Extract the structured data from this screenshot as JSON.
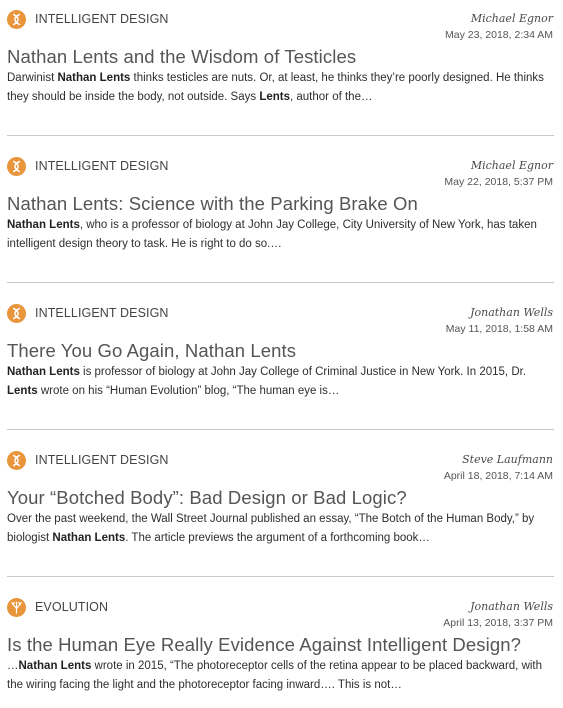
{
  "colors": {
    "accent": "#e8953c",
    "icon_evolution": "#e8953c",
    "divider": "#c9c9c9"
  },
  "articles": [
    {
      "category": "INTELLIGENT DESIGN",
      "category_icon": "dna-helix-icon",
      "author": "Michael Egnor",
      "date": "May 23, 2018, 2:34 AM",
      "title": "Nathan Lents and the Wisdom of Testicles",
      "excerpt": [
        {
          "text": "Darwinist ",
          "bold": false
        },
        {
          "text": "Nathan Lents",
          "bold": true
        },
        {
          "text": " thinks testicles are nuts. Or, at least, he thinks they’re poorly designed. He thinks they should be inside the body, not outside. Says ",
          "bold": false
        },
        {
          "text": "Lents",
          "bold": true
        },
        {
          "text": ", author of the…",
          "bold": false
        }
      ]
    },
    {
      "category": "INTELLIGENT DESIGN",
      "category_icon": "dna-helix-icon",
      "author": "Michael Egnor",
      "date": "May 22, 2018, 5:37 PM",
      "title": "Nathan Lents: Science with the Parking Brake On",
      "excerpt": [
        {
          "text": "Nathan Lents",
          "bold": true
        },
        {
          "text": ", who is a professor of biology at John Jay College, City University of New York, has taken intelligent design theory to task. He is right to do so.…",
          "bold": false
        }
      ]
    },
    {
      "category": "INTELLIGENT DESIGN",
      "category_icon": "dna-helix-icon",
      "author": "Jonathan Wells",
      "date": "May 11, 2018, 1:58 AM",
      "title": "There You Go Again, Nathan Lents",
      "excerpt": [
        {
          "text": "Nathan Lents",
          "bold": true
        },
        {
          "text": " is professor of biology at John Jay College of Criminal Justice in New York. In 2015, Dr. ",
          "bold": false
        },
        {
          "text": "Lents",
          "bold": true
        },
        {
          "text": " wrote on his “Human Evolution” blog, “The human eye is…",
          "bold": false
        }
      ]
    },
    {
      "category": "INTELLIGENT DESIGN",
      "category_icon": "dna-helix-icon",
      "author": "Steve Laufmann",
      "date": "April 18, 2018, 7:14 AM",
      "title": "Your “Botched Body”: Bad Design or Bad Logic?",
      "excerpt": [
        {
          "text": "Over the past weekend, the Wall Street Journal published an essay, “The Botch of the Human Body,” by biologist ",
          "bold": false
        },
        {
          "text": "Nathan Lents",
          "bold": true
        },
        {
          "text": ". The article previews the argument of a forthcoming book…",
          "bold": false
        }
      ]
    },
    {
      "category": "EVOLUTION",
      "category_icon": "branching-tree-icon",
      "author": "Jonathan Wells",
      "date": "April 13, 2018, 3:37 PM",
      "title": "Is the Human Eye Really Evidence Against Intelligent Design?",
      "excerpt": [
        {
          "text": "…",
          "bold": false
        },
        {
          "text": "Nathan Lents",
          "bold": true
        },
        {
          "text": " wrote in 2015, “The photoreceptor cells of the retina appear to be placed backward, with the wiring facing the light and the photoreceptor facing inward…. This is not…",
          "bold": false
        }
      ]
    }
  ]
}
